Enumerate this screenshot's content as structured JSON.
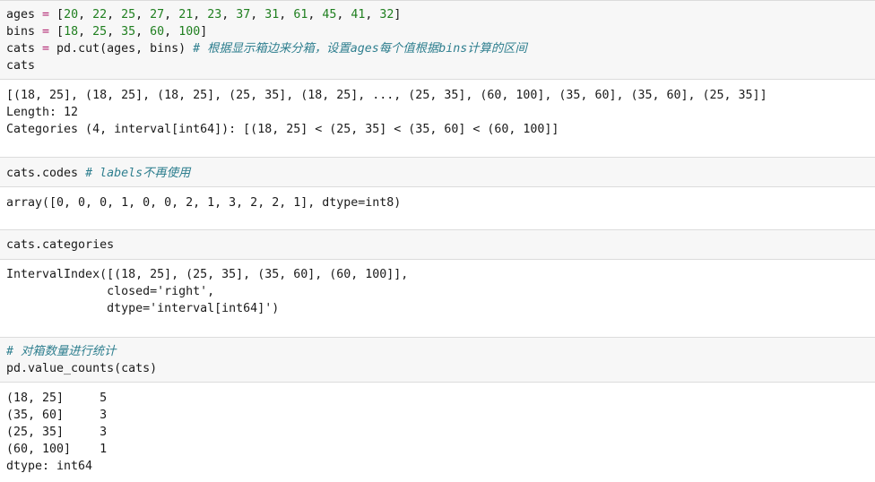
{
  "cells": [
    {
      "type": "input",
      "lines": [
        [
          {
            "t": "ages ",
            "c": "kw"
          },
          {
            "t": "=",
            "c": "op"
          },
          {
            "t": " [",
            "c": "kw"
          },
          {
            "t": "20",
            "c": "num"
          },
          {
            "t": ", ",
            "c": "kw"
          },
          {
            "t": "22",
            "c": "num"
          },
          {
            "t": ", ",
            "c": "kw"
          },
          {
            "t": "25",
            "c": "num"
          },
          {
            "t": ", ",
            "c": "kw"
          },
          {
            "t": "27",
            "c": "num"
          },
          {
            "t": ", ",
            "c": "kw"
          },
          {
            "t": "21",
            "c": "num"
          },
          {
            "t": ", ",
            "c": "kw"
          },
          {
            "t": "23",
            "c": "num"
          },
          {
            "t": ", ",
            "c": "kw"
          },
          {
            "t": "37",
            "c": "num"
          },
          {
            "t": ", ",
            "c": "kw"
          },
          {
            "t": "31",
            "c": "num"
          },
          {
            "t": ", ",
            "c": "kw"
          },
          {
            "t": "61",
            "c": "num"
          },
          {
            "t": ", ",
            "c": "kw"
          },
          {
            "t": "45",
            "c": "num"
          },
          {
            "t": ", ",
            "c": "kw"
          },
          {
            "t": "41",
            "c": "num"
          },
          {
            "t": ", ",
            "c": "kw"
          },
          {
            "t": "32",
            "c": "num"
          },
          {
            "t": "]",
            "c": "kw"
          }
        ],
        [
          {
            "t": "bins ",
            "c": "kw"
          },
          {
            "t": "=",
            "c": "op"
          },
          {
            "t": " [",
            "c": "kw"
          },
          {
            "t": "18",
            "c": "num"
          },
          {
            "t": ", ",
            "c": "kw"
          },
          {
            "t": "25",
            "c": "num"
          },
          {
            "t": ", ",
            "c": "kw"
          },
          {
            "t": "35",
            "c": "num"
          },
          {
            "t": ", ",
            "c": "kw"
          },
          {
            "t": "60",
            "c": "num"
          },
          {
            "t": ", ",
            "c": "kw"
          },
          {
            "t": "100",
            "c": "num"
          },
          {
            "t": "]",
            "c": "kw"
          }
        ],
        [
          {
            "t": "cats ",
            "c": "kw"
          },
          {
            "t": "=",
            "c": "op"
          },
          {
            "t": " pd.cut(ages, bins) ",
            "c": "kw"
          },
          {
            "t": "# 根据显示箱边来分箱，设置ages每个值根据bins计算的区间",
            "c": "cm"
          }
        ],
        [
          {
            "t": "cats",
            "c": "kw"
          }
        ]
      ]
    },
    {
      "type": "output",
      "lines": [
        [
          {
            "t": "[(18, 25], (18, 25], (18, 25], (25, 35], (18, 25], ..., (25, 35], (60, 100], (35, 60], (35, 60], (25, 35]]",
            "c": "kw"
          }
        ],
        [
          {
            "t": "Length: 12",
            "c": "kw"
          }
        ],
        [
          {
            "t": "Categories (4, interval[int64]): [(18, 25] < (25, 35] < (35, 60] < (60, 100]]",
            "c": "kw"
          }
        ]
      ]
    },
    {
      "type": "input",
      "lines": [
        [
          {
            "t": "cats.codes ",
            "c": "kw"
          },
          {
            "t": "# labels不再使用",
            "c": "cm"
          }
        ]
      ]
    },
    {
      "type": "output",
      "lines": [
        [
          {
            "t": "array([0, 0, 0, 1, 0, 0, 2, 1, 3, 2, 2, 1], dtype=int8)",
            "c": "kw"
          }
        ]
      ]
    },
    {
      "type": "input",
      "lines": [
        [
          {
            "t": "cats.categories",
            "c": "kw"
          }
        ]
      ]
    },
    {
      "type": "output",
      "lines": [
        [
          {
            "t": "IntervalIndex([(18, 25], (25, 35], (35, 60], (60, 100]],",
            "c": "kw"
          }
        ],
        [
          {
            "t": "              closed='right',",
            "c": "kw"
          }
        ],
        [
          {
            "t": "              dtype='interval[int64]')",
            "c": "kw"
          }
        ]
      ]
    },
    {
      "type": "input",
      "lines": [
        [
          {
            "t": "# 对箱数量进行统计",
            "c": "cm"
          }
        ],
        [
          {
            "t": "pd.value_counts(cats)",
            "c": "kw"
          }
        ]
      ]
    },
    {
      "type": "output",
      "lines": [
        [
          {
            "t": "(18, 25]     5",
            "c": "kw"
          }
        ],
        [
          {
            "t": "(35, 60]     3",
            "c": "kw"
          }
        ],
        [
          {
            "t": "(25, 35]     3",
            "c": "kw"
          }
        ],
        [
          {
            "t": "(60, 100]    1",
            "c": "kw"
          }
        ],
        [
          {
            "t": "dtype: int64",
            "c": "kw"
          }
        ]
      ]
    }
  ]
}
